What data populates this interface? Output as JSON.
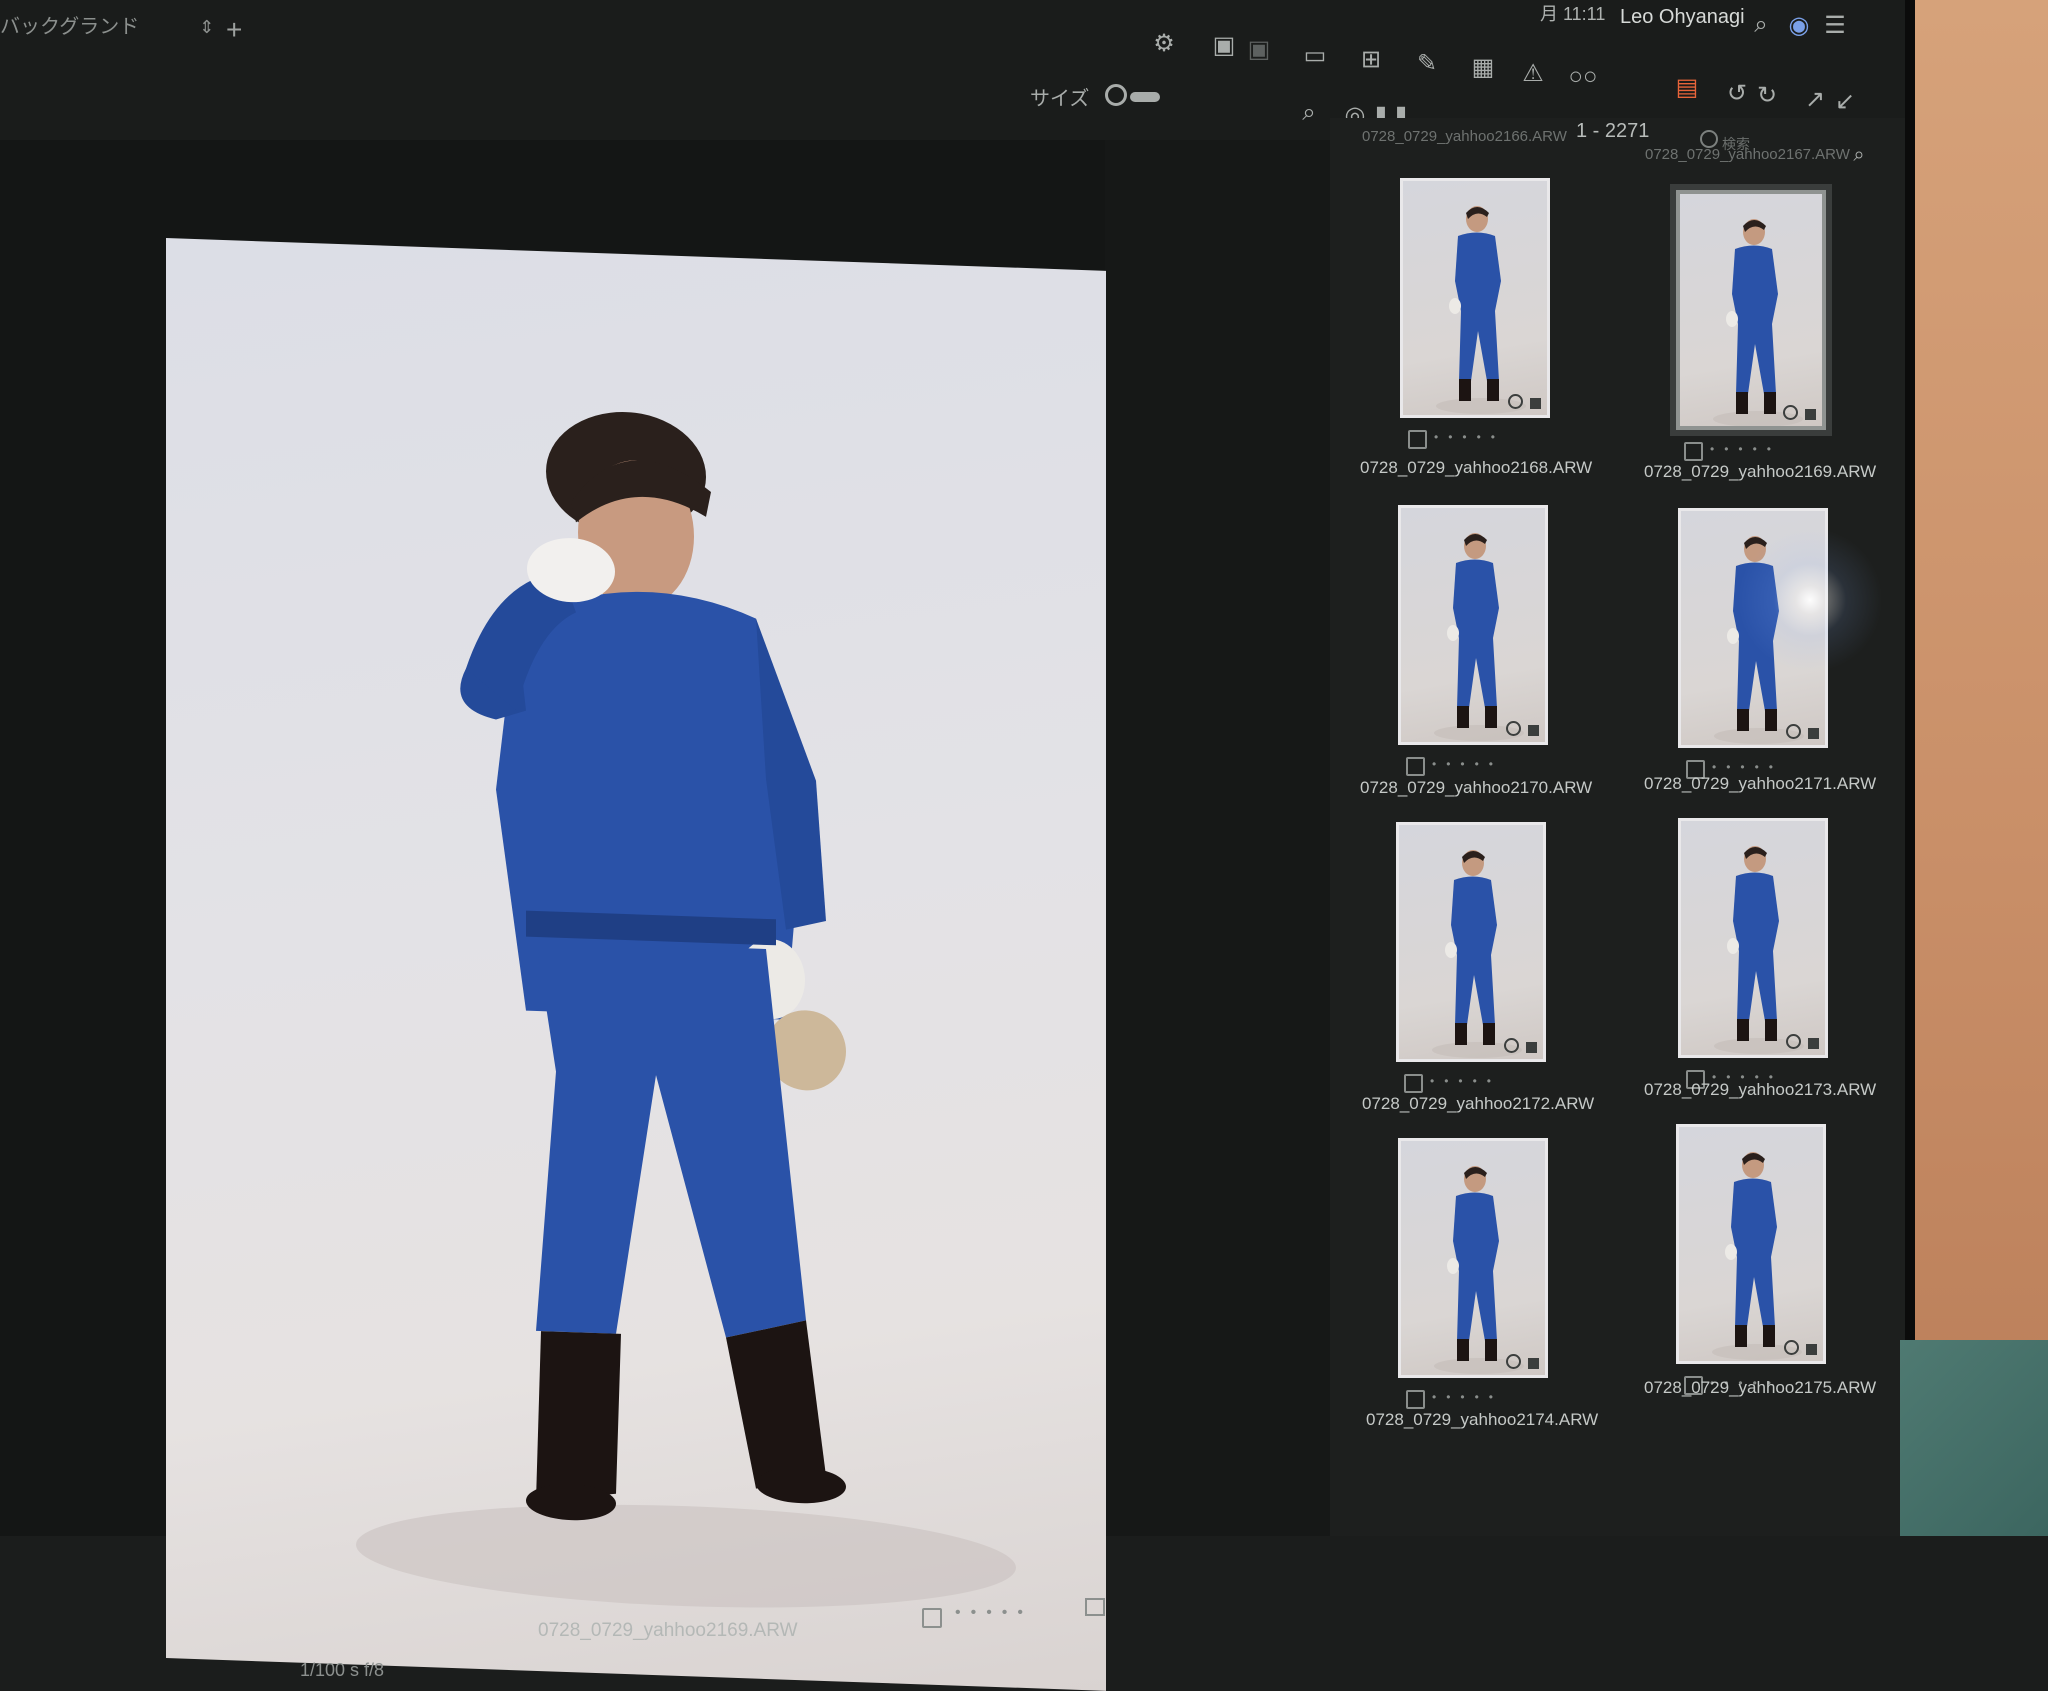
{
  "toolbar": {
    "background_select": "バックグランド",
    "size_label": "サイズ",
    "time": "月 11:11",
    "user": "Leo Ohyanagi"
  },
  "viewer": {
    "filename": "0728_0729_yahhoo2169.ARW",
    "exif": "1/100 s    f/8"
  },
  "browser": {
    "count": "1 - 2271",
    "search_placeholder": "検索",
    "cut_names": [
      "0728_0729_yahhoo2166.ARW",
      "0728_0729_yahhoo2167.ARW"
    ],
    "thumbnails": [
      {
        "name": "0728_0729_yahhoo2168.ARW"
      },
      {
        "name": "0728_0729_yahhoo2169.ARW",
        "selected": true
      },
      {
        "name": "0728_0729_yahhoo2170.ARW"
      },
      {
        "name": "0728_0729_yahhoo2171.ARW"
      },
      {
        "name": "0728_0729_yahhoo2172.ARW"
      },
      {
        "name": "0728_0729_yahhoo2173.ARW"
      },
      {
        "name": "0728_0729_yahhoo2174.ARW"
      },
      {
        "name": "0728_0729_yahhoo2175.ARW"
      }
    ]
  },
  "colors": {
    "accent_orange": "#e8643a",
    "suit_blue": "#2a52a8",
    "panel": "#1d1f1e"
  }
}
